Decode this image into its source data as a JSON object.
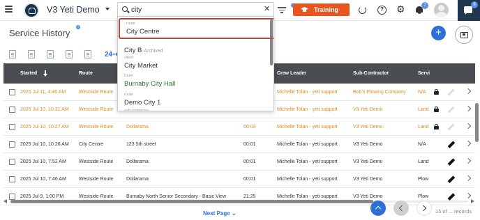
{
  "topbar": {
    "app_name": "V3 Yeti Demo",
    "search_value": "city",
    "training_label": "Training",
    "notification_count": "7",
    "chat_count": "6"
  },
  "page": {
    "title": "Service History",
    "hours_label": "24"
  },
  "table": {
    "headers": {
      "started": "Started",
      "route": "Route",
      "crew_leader": "Crew Leader",
      "sub_contractor": "Sub-Contractor",
      "service": "Servi"
    },
    "rows": [
      {
        "started": "2025 Jul 11, 4:46 AM",
        "route": "Westside Route",
        "site": "",
        "duration": "",
        "crew": "Michelle Tolan - yeti support",
        "sub": "Bob's Plowing Company",
        "service": "N/A",
        "locked": true,
        "edit": "disabled",
        "highlight": true
      },
      {
        "started": "2025 Jul 10, 10:31 AM",
        "route": "Westside Route",
        "site": "",
        "duration": "",
        "crew": "Michelle Tolan - yeti support",
        "sub": "V3 Yeti Demo",
        "service": "Land",
        "locked": true,
        "edit": "disabled",
        "highlight": true
      },
      {
        "started": "2025 Jul 10, 10:27 AM",
        "route": "Westside Route",
        "site": "Dollarama",
        "duration": "00:03",
        "crew": "Michelle Tolan - yeti support",
        "sub": "V3 Yeti Demo",
        "service": "Land",
        "locked": true,
        "edit": "disabled",
        "highlight": true
      },
      {
        "started": "2025 Jul 10, 10:26 AM",
        "route": "City Centre",
        "site": "123 5th street",
        "duration": "00:01",
        "crew": "Michelle Tolan - yeti support",
        "sub": "V3 Yeti Demo",
        "service": "N/A",
        "locked": false,
        "edit": "enabled",
        "highlight": false
      },
      {
        "started": "2025 Jul 10, 7:52 AM",
        "route": "Westside Route",
        "site": "Dollarama",
        "duration": "00:01",
        "crew": "Michelle Tolan - yeti support",
        "sub": "V3 Yeti Demo",
        "service": "Land",
        "locked": false,
        "edit": "enabled",
        "highlight": false
      },
      {
        "started": "2025 Jul 10, 7:46 AM",
        "route": "Westside Route",
        "site": "Dollarama",
        "duration": "00:01",
        "crew": "Michelle Tolan - yeti support",
        "sub": "V3 Yeti Demo",
        "service": "Plow",
        "locked": false,
        "edit": "enabled",
        "highlight": false
      },
      {
        "started": "2025 Jul 9, 1:00 PM",
        "route": "Westside Route",
        "site": "Burnaby North Senior Secondary - Basic View",
        "duration": "21:25",
        "crew": "Michelle Tolan - yeti support",
        "sub": "V3 Yeti Demo",
        "service": "Plow",
        "locked": false,
        "edit": "enabled",
        "highlight": false
      }
    ]
  },
  "search_results": [
    {
      "type": "route",
      "name": "City Centre",
      "archived": "",
      "selected": true
    },
    {
      "type": "",
      "name": "City B",
      "archived": "Archived",
      "selected": false
    },
    {
      "type": "client",
      "name": "City Market",
      "archived": "",
      "selected": false
    },
    {
      "type": "route",
      "name": "Burnaby City Hall",
      "archived": "",
      "selected": false
    },
    {
      "type": "route",
      "name": "Demo City 1",
      "archived": "",
      "selected": false
    },
    {
      "type": "sub contractor",
      "name": "",
      "archived": "",
      "selected": false
    }
  ],
  "pagination": {
    "next_page_label": "Next Page",
    "records_label": "15 of ... records"
  },
  "colors": {
    "accent": "#2f6fd6",
    "training": "#e8551f",
    "highlight_row_text": "#e08a1e",
    "header_bg": "#4a4d52",
    "selection_border": "#b5453a"
  }
}
